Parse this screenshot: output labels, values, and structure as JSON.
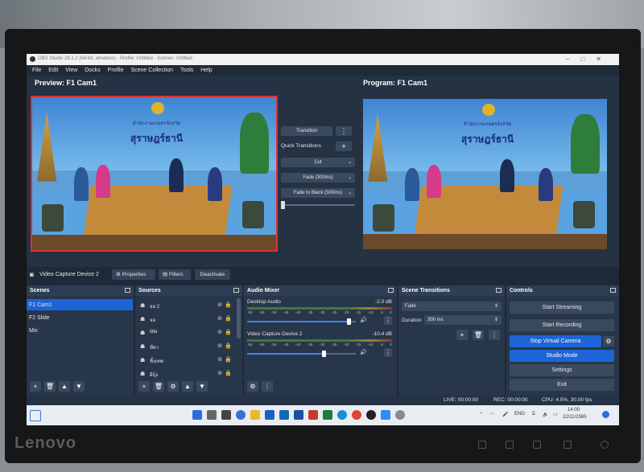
{
  "window": {
    "title": "OBS Studio 28.1.2 (64-bit, windows) - Profile: Untitled - Scenes: Untitled"
  },
  "menu": [
    "File",
    "Edit",
    "View",
    "Docks",
    "Profile",
    "Scene Collection",
    "Tools",
    "Help"
  ],
  "preview": {
    "label": "Preview: F1 Cam1"
  },
  "program": {
    "label": "Program: F1 Cam1"
  },
  "video": {
    "banner_line1": "สำนักงานเกษตรจังหวัด",
    "banner_line2": "สุราษฎร์ธานี"
  },
  "transition_controls": {
    "transition_label": "Transition",
    "quick_transitions_label": "Quick Transitions",
    "options": [
      "Cut",
      "Fade (300ms)",
      "Fade to Black (300ms)"
    ]
  },
  "source_toolbar": {
    "source_name": "Video Capture Device 2",
    "properties_label": "Properties",
    "filters_label": "Filters",
    "deactivate_label": "Deactivate"
  },
  "scenes": {
    "title": "Scenes",
    "items": [
      "F1 Cam1",
      "F2 Slide",
      "Mix"
    ],
    "selected_index": 0
  },
  "sources": {
    "title": "Sources",
    "items": [
      "จอ 2",
      "จอ",
      "title",
      "ทีดา",
      "ทิ้งเทพ",
      "ผีบุ้ง"
    ]
  },
  "audio_mixer": {
    "title": "Audio Mixer",
    "channels": [
      {
        "name": "Desktop Audio",
        "db": "-2.0 dB",
        "volume": 0.93
      },
      {
        "name": "Video Capture Device 2",
        "db": "-10.4 dB",
        "volume": 0.7
      }
    ],
    "ticks": [
      "-60",
      "-55",
      "-50",
      "-45",
      "-40",
      "-35",
      "-30",
      "-25",
      "-20",
      "-15",
      "-10",
      "-5",
      "0"
    ]
  },
  "scene_transitions": {
    "title": "Scene Transitions",
    "selected": "Fade",
    "duration_label": "Duration",
    "duration_value": "300 ms"
  },
  "controls": {
    "title": "Controls",
    "start_streaming": "Start Streaming",
    "start_recording": "Start Recording",
    "stop_virtual_camera": "Stop Virtual Camera",
    "studio_mode": "Studio Mode",
    "settings": "Settings",
    "exit": "Exit"
  },
  "status": {
    "live": "LIVE: 00:00:00",
    "rec": "REC: 00:00:00",
    "cpu": "CPU: 4.5%, 30.00 fps"
  },
  "taskbar": {
    "lang": "ENG",
    "time": "14:00",
    "date": "22/11/2565"
  },
  "monitor": {
    "brand": "Lenovo"
  },
  "colors": {
    "accent": "#1d64d6",
    "panel": "#28364a",
    "recording_red": "#e03030"
  }
}
